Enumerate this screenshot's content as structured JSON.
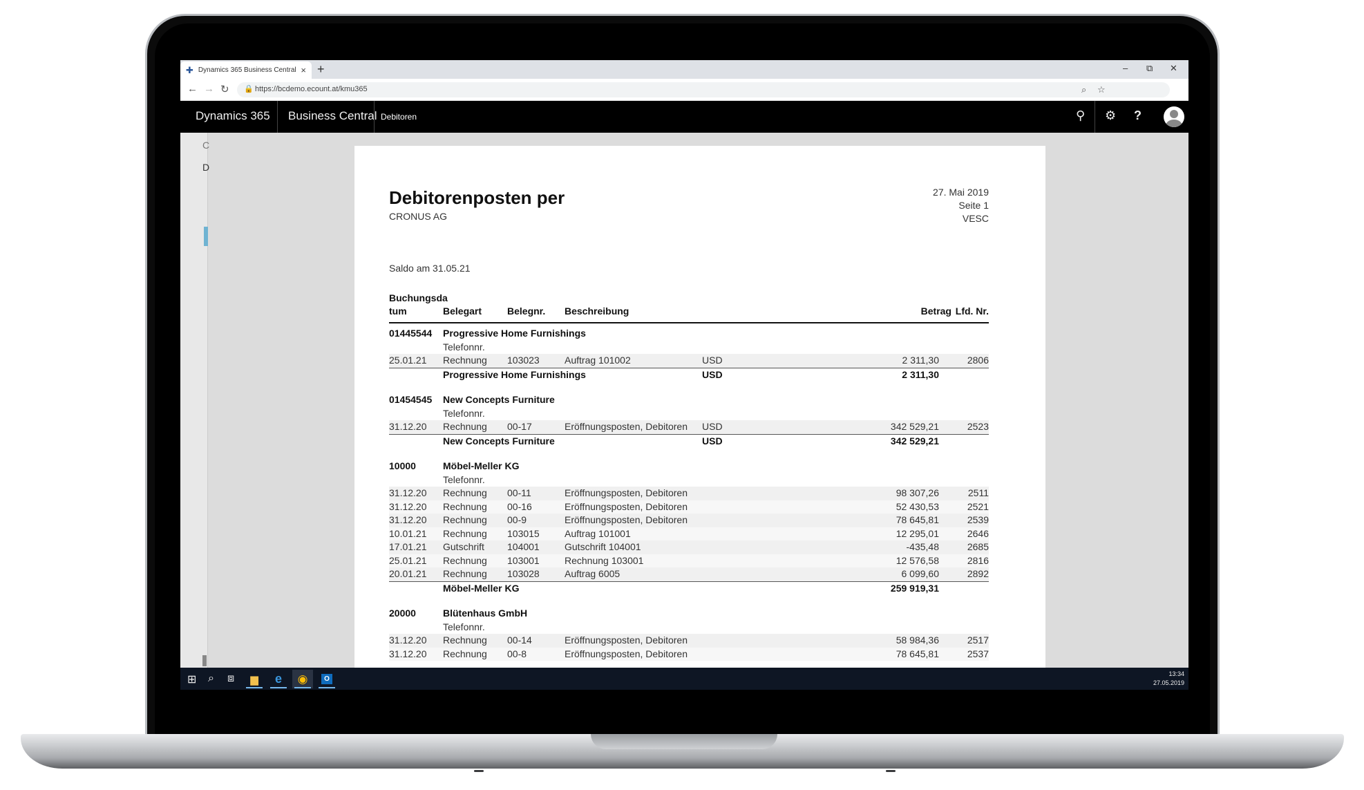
{
  "browser": {
    "tab_title": "Dynamics 365 Business Central",
    "url": "https://bcdemo.ecount.at/kmu365"
  },
  "app_header": {
    "brand": "Dynamics 365",
    "app_name": "Business Central",
    "breadcrumb": "Debitoren"
  },
  "report": {
    "title": "Debitorenposten per",
    "company": "CRONUS AG",
    "date": "27. Mai 2019",
    "page": "Seite 1",
    "user": "VESC",
    "saldo": "Saldo am 31.05.21",
    "columns": {
      "posting_date_1": "Buchungsda",
      "posting_date_2": "tum",
      "doc_type": "Belegart",
      "doc_no": "Belegnr.",
      "description": "Beschreibung",
      "amount": "Betrag",
      "entry_no": "Lfd. Nr."
    },
    "phone_label": "Telefonnr.",
    "groups": [
      {
        "customer_no": "01445544",
        "name": "Progressive Home Furnishings",
        "entries": [
          {
            "date": "25.01.21",
            "type": "Rechnung",
            "doc": "103023",
            "desc": "Auftrag 101002",
            "cur": "USD",
            "amount": "2 311,30",
            "entry": "2806"
          }
        ],
        "subtotal_currency": "USD",
        "subtotal": "2 311,30"
      },
      {
        "customer_no": "01454545",
        "name": "New Concepts Furniture",
        "entries": [
          {
            "date": "31.12.20",
            "type": "Rechnung",
            "doc": "00-17",
            "desc": "Eröffnungsposten, Debitoren",
            "cur": "USD",
            "amount": "342 529,21",
            "entry": "2523"
          }
        ],
        "subtotal_currency": "USD",
        "subtotal": "342 529,21"
      },
      {
        "customer_no": "10000",
        "name": "Möbel-Meller KG",
        "entries": [
          {
            "date": "31.12.20",
            "type": "Rechnung",
            "doc": "00-11",
            "desc": "Eröffnungsposten, Debitoren",
            "cur": "",
            "amount": "98 307,26",
            "entry": "2511"
          },
          {
            "date": "31.12.20",
            "type": "Rechnung",
            "doc": "00-16",
            "desc": "Eröffnungsposten, Debitoren",
            "cur": "",
            "amount": "52 430,53",
            "entry": "2521"
          },
          {
            "date": "31.12.20",
            "type": "Rechnung",
            "doc": "00-9",
            "desc": "Eröffnungsposten, Debitoren",
            "cur": "",
            "amount": "78 645,81",
            "entry": "2539"
          },
          {
            "date": "10.01.21",
            "type": "Rechnung",
            "doc": "103015",
            "desc": "Auftrag 101001",
            "cur": "",
            "amount": "12 295,01",
            "entry": "2646"
          },
          {
            "date": "17.01.21",
            "type": "Gutschrift",
            "doc": "104001",
            "desc": "Gutschrift 104001",
            "cur": "",
            "amount": "-435,48",
            "entry": "2685"
          },
          {
            "date": "25.01.21",
            "type": "Rechnung",
            "doc": "103001",
            "desc": "Rechnung 103001",
            "cur": "",
            "amount": "12 576,58",
            "entry": "2816"
          },
          {
            "date": "20.01.21",
            "type": "Rechnung",
            "doc": "103028",
            "desc": "Auftrag 6005",
            "cur": "",
            "amount": "6 099,60",
            "entry": "2892"
          }
        ],
        "subtotal_currency": "",
        "subtotal": "259 919,31"
      },
      {
        "customer_no": "20000",
        "name": "Blütenhaus GmbH",
        "entries": [
          {
            "date": "31.12.20",
            "type": "Rechnung",
            "doc": "00-14",
            "desc": "Eröffnungsposten, Debitoren",
            "cur": "",
            "amount": "58 984,36",
            "entry": "2517"
          },
          {
            "date": "31.12.20",
            "type": "Rechnung",
            "doc": "00-8",
            "desc": "Eröffnungsposten, Debitoren",
            "cur": "",
            "amount": "78 645,81",
            "entry": "2537"
          }
        ]
      }
    ]
  },
  "taskbar": {
    "time": "13:34",
    "date": "27.05.2019"
  },
  "icons": [
    "windows-start-icon",
    "search-icon",
    "task-view-icon",
    "file-explorer-icon",
    "edge-icon",
    "chrome-icon",
    "outlook-icon",
    "lightbulb-icon",
    "gear-icon",
    "help-icon",
    "avatar-icon"
  ]
}
